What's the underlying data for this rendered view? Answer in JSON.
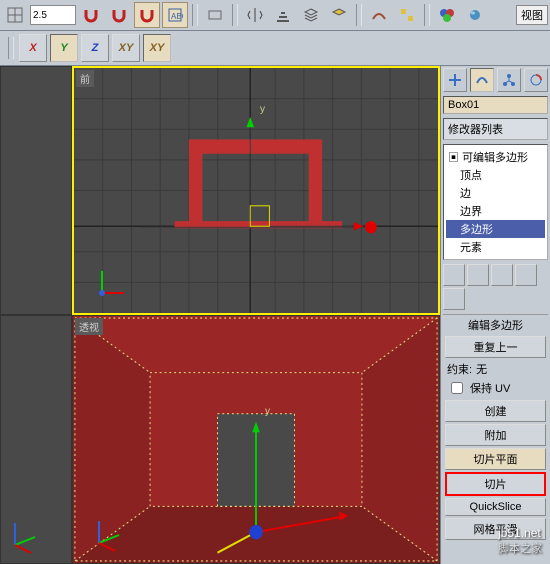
{
  "toolbar": {
    "spinner_value": "2.5",
    "view_menu": "视图"
  },
  "axis": {
    "x": "X",
    "y": "Y",
    "z": "Z",
    "xy": "XY",
    "xy2": "XY"
  },
  "viewports": {
    "front": {
      "label": "前",
      "axis_y": "y"
    },
    "persp": {
      "label": "透视",
      "axis_y": "y"
    }
  },
  "panel": {
    "object_name": "Box01",
    "modifier_list_label": "修改器列表",
    "tree": {
      "root": "可编辑多边形",
      "items": [
        "顶点",
        "边",
        "边界",
        "多边形",
        "元素"
      ],
      "selected_index": 3
    },
    "rollout": {
      "edit_label": "编辑多边形",
      "repeat": "重复上一",
      "constraint_label": "约束:",
      "constraint_value": "无",
      "preserve_uv": "保持 UV",
      "create": "创建",
      "attach": "附加",
      "slice_plane": "切片平面",
      "slice": "切片",
      "quickslice": "QuickSlice",
      "mesh_smooth": "网格平滑"
    }
  },
  "watermark": {
    "url": "jb51.net",
    "text": "脚本之家"
  }
}
